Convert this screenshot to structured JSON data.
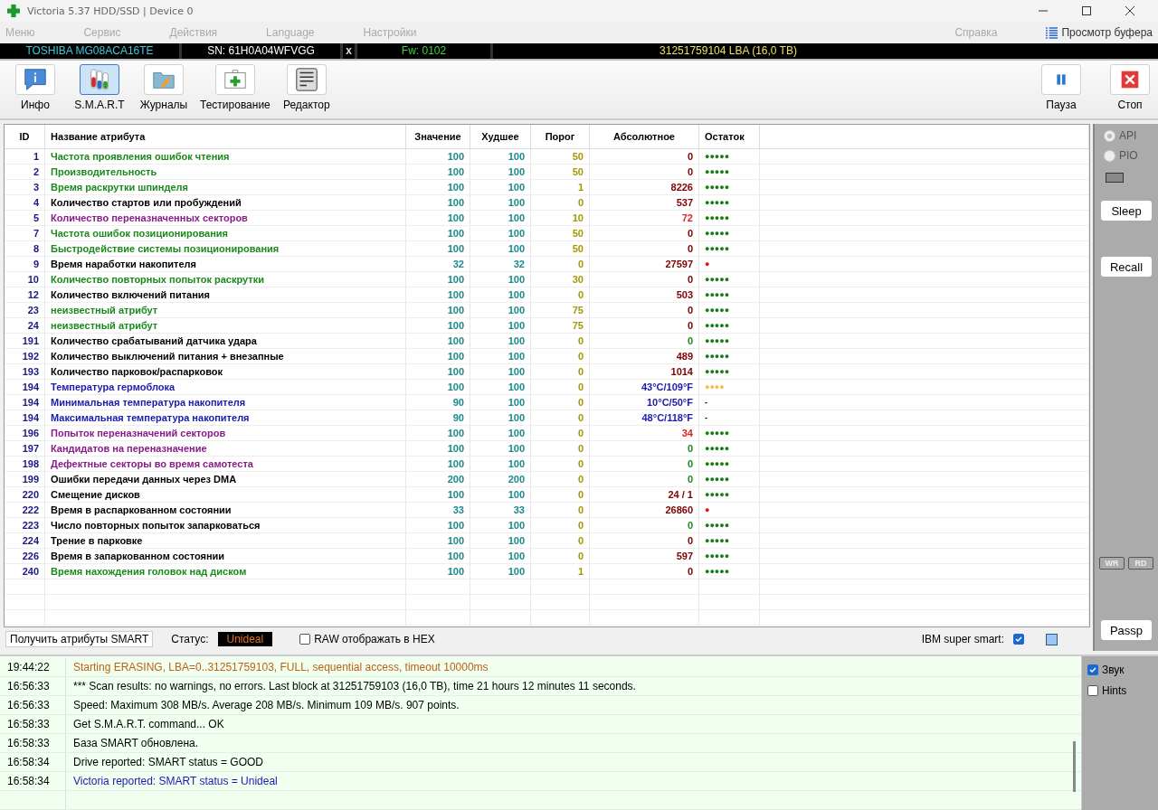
{
  "window": {
    "title": "Victoria 5.37 HDD/SSD | Device 0"
  },
  "menu": [
    {
      "label": "Меню",
      "disabled": true
    },
    {
      "label": "Сервис",
      "disabled": true
    },
    {
      "label": "Действия",
      "disabled": true
    },
    {
      "label": "Language",
      "disabled": true
    },
    {
      "label": "Настройки",
      "disabled": true
    },
    {
      "label": "Справка",
      "disabled": true
    }
  ],
  "buffer_link": {
    "label": "Просмотр буфера"
  },
  "drive_bar": {
    "model": "TOSHIBA MG08ACA16TE",
    "serial": "SN: 61H0A04WFVGG",
    "close": "x",
    "firmware": "Fw: 0102",
    "capacity": "31251759104 LBA (16,0 TB)"
  },
  "toolbar": [
    {
      "kind": "info",
      "label": "Инфо",
      "selected": false
    },
    {
      "kind": "smart",
      "label": "S.M.A.R.T",
      "selected": true
    },
    {
      "kind": "logs",
      "label": "Журналы",
      "selected": false
    },
    {
      "kind": "test",
      "label": "Тестирование",
      "selected": false
    },
    {
      "kind": "editor",
      "label": "Редактор",
      "selected": false
    }
  ],
  "toolbar_right": [
    {
      "kind": "pause",
      "label": "Пауза"
    },
    {
      "kind": "stop",
      "label": "Стоп"
    }
  ],
  "table": {
    "columns": [
      "ID",
      "Название атрибута",
      "Значение",
      "Худшее",
      "Порог",
      "Абсолютное",
      "Остаток"
    ],
    "rows": [
      {
        "id": "1",
        "name": "Частота проявления ошибок чтения",
        "color": "#1a8a1a",
        "value": "100",
        "worst": "100",
        "threshold": "50",
        "raw": {
          "text": "0",
          "color": "#800000"
        },
        "health": {
          "text": "●●●●●",
          "color": "#1a7a1a"
        }
      },
      {
        "id": "2",
        "name": "Производительность",
        "color": "#1a8a1a",
        "value": "100",
        "worst": "100",
        "threshold": "50",
        "raw": {
          "text": "0",
          "color": "#800000"
        },
        "health": {
          "text": "●●●●●",
          "color": "#1a7a1a"
        }
      },
      {
        "id": "3",
        "name": "Время раскрутки шпинделя",
        "color": "#1a8a1a",
        "value": "100",
        "worst": "100",
        "threshold": "1",
        "raw": {
          "text": "8226",
          "color": "#800000"
        },
        "health": {
          "text": "●●●●●",
          "color": "#1a7a1a"
        }
      },
      {
        "id": "4",
        "name": "Количество стартов или пробуждений",
        "color": "#000000",
        "value": "100",
        "worst": "100",
        "threshold": "0",
        "raw": {
          "text": "537",
          "color": "#800000"
        },
        "health": {
          "text": "●●●●●",
          "color": "#1a7a1a"
        }
      },
      {
        "id": "5",
        "name": "Количество переназначенных секторов",
        "color": "#8a1a8a",
        "value": "100",
        "worst": "100",
        "threshold": "10",
        "raw": {
          "text": "72",
          "color": "#e02020"
        },
        "health": {
          "text": "●●●●●",
          "color": "#1a7a1a"
        }
      },
      {
        "id": "7",
        "name": "Частота ошибок позиционирования",
        "color": "#1a8a1a",
        "value": "100",
        "worst": "100",
        "threshold": "50",
        "raw": {
          "text": "0",
          "color": "#800000"
        },
        "health": {
          "text": "●●●●●",
          "color": "#1a7a1a"
        }
      },
      {
        "id": "8",
        "name": "Быстродействие системы позиционирования",
        "color": "#1a8a1a",
        "value": "100",
        "worst": "100",
        "threshold": "50",
        "raw": {
          "text": "0",
          "color": "#800000"
        },
        "health": {
          "text": "●●●●●",
          "color": "#1a7a1a"
        }
      },
      {
        "id": "9",
        "name": "Время наработки накопителя",
        "color": "#000000",
        "value": "32",
        "worst": "32",
        "threshold": "0",
        "raw": {
          "text": "27597",
          "color": "#800000"
        },
        "health": {
          "text": "●",
          "color": "#e01010"
        }
      },
      {
        "id": "10",
        "name": "Количество повторных попыток раскрутки",
        "color": "#1a8a1a",
        "value": "100",
        "worst": "100",
        "threshold": "30",
        "raw": {
          "text": "0",
          "color": "#800000"
        },
        "health": {
          "text": "●●●●●",
          "color": "#1a7a1a"
        }
      },
      {
        "id": "12",
        "name": "Количество включений питания",
        "color": "#000000",
        "value": "100",
        "worst": "100",
        "threshold": "0",
        "raw": {
          "text": "503",
          "color": "#800000"
        },
        "health": {
          "text": "●●●●●",
          "color": "#1a7a1a"
        }
      },
      {
        "id": "23",
        "name": "неизвестный атрибут",
        "color": "#1a8a1a",
        "value": "100",
        "worst": "100",
        "threshold": "75",
        "raw": {
          "text": "0",
          "color": "#800000"
        },
        "health": {
          "text": "●●●●●",
          "color": "#1a7a1a"
        }
      },
      {
        "id": "24",
        "name": "неизвестный атрибут",
        "color": "#1a8a1a",
        "value": "100",
        "worst": "100",
        "threshold": "75",
        "raw": {
          "text": "0",
          "color": "#800000"
        },
        "health": {
          "text": "●●●●●",
          "color": "#1a7a1a"
        }
      },
      {
        "id": "191",
        "name": "Количество срабатываний датчика удара",
        "color": "#000000",
        "value": "100",
        "worst": "100",
        "threshold": "0",
        "raw": {
          "text": "0",
          "color": "#1a8a1a"
        },
        "health": {
          "text": "●●●●●",
          "color": "#1a7a1a"
        }
      },
      {
        "id": "192",
        "name": "Количество выключений питания + внезапные",
        "color": "#000000",
        "value": "100",
        "worst": "100",
        "threshold": "0",
        "raw": {
          "text": "489",
          "color": "#800000"
        },
        "health": {
          "text": "●●●●●",
          "color": "#1a7a1a"
        }
      },
      {
        "id": "193",
        "name": "Количество парковок/распарковок",
        "color": "#000000",
        "value": "100",
        "worst": "100",
        "threshold": "0",
        "raw": {
          "text": "1014",
          "color": "#800000"
        },
        "health": {
          "text": "●●●●●",
          "color": "#1a7a1a"
        }
      },
      {
        "id": "194",
        "name": "Температура гермоблока",
        "color": "#1a1ab0",
        "value": "100",
        "worst": "100",
        "threshold": "0",
        "raw": {
          "text": "43°C/109°F",
          "color": "#1a1ab0"
        },
        "health": {
          "text": "●●●●",
          "color": "#f0c040"
        }
      },
      {
        "id": "194",
        "name": "Минимальная температура накопителя",
        "color": "#1a1ab0",
        "value": "90",
        "worst": "100",
        "threshold": "0",
        "raw": {
          "text": "10°C/50°F",
          "color": "#1a1ab0"
        },
        "health": {
          "text": "-"
        }
      },
      {
        "id": "194",
        "name": "Максимальная температура накопителя",
        "color": "#1a1ab0",
        "value": "90",
        "worst": "100",
        "threshold": "0",
        "raw": {
          "text": "48°C/118°F",
          "color": "#1a1ab0"
        },
        "health": {
          "text": "-"
        }
      },
      {
        "id": "196",
        "name": "Попыток переназначений секторов",
        "color": "#8a1a8a",
        "value": "100",
        "worst": "100",
        "threshold": "0",
        "raw": {
          "text": "34",
          "color": "#e02020"
        },
        "health": {
          "text": "●●●●●",
          "color": "#1a7a1a"
        }
      },
      {
        "id": "197",
        "name": "Кандидатов на переназначение",
        "color": "#8a1a8a",
        "value": "100",
        "worst": "100",
        "threshold": "0",
        "raw": {
          "text": "0",
          "color": "#1a8a1a"
        },
        "health": {
          "text": "●●●●●",
          "color": "#1a7a1a"
        }
      },
      {
        "id": "198",
        "name": "Дефектные секторы во время самотеста",
        "color": "#8a1a8a",
        "value": "100",
        "worst": "100",
        "threshold": "0",
        "raw": {
          "text": "0",
          "color": "#1a8a1a"
        },
        "health": {
          "text": "●●●●●",
          "color": "#1a7a1a"
        }
      },
      {
        "id": "199",
        "name": "Ошибки передачи данных через DMA",
        "color": "#000000",
        "value": "200",
        "worst": "200",
        "threshold": "0",
        "raw": {
          "text": "0",
          "color": "#1a8a1a"
        },
        "health": {
          "text": "●●●●●",
          "color": "#1a7a1a"
        }
      },
      {
        "id": "220",
        "name": "Смещение дисков",
        "color": "#000000",
        "value": "100",
        "worst": "100",
        "threshold": "0",
        "raw": {
          "text": "24 / 1",
          "color": "#800000"
        },
        "health": {
          "text": "●●●●●",
          "color": "#1a7a1a"
        }
      },
      {
        "id": "222",
        "name": "Время в распаркованном состоянии",
        "color": "#000000",
        "value": "33",
        "worst": "33",
        "threshold": "0",
        "raw": {
          "text": "26860",
          "color": "#800000"
        },
        "health": {
          "text": "●",
          "color": "#e01010"
        }
      },
      {
        "id": "223",
        "name": "Число повторных попыток запарковаться",
        "color": "#000000",
        "value": "100",
        "worst": "100",
        "threshold": "0",
        "raw": {
          "text": "0",
          "color": "#1a8a1a"
        },
        "health": {
          "text": "●●●●●",
          "color": "#1a7a1a"
        }
      },
      {
        "id": "224",
        "name": "Трение в парковке",
        "color": "#000000",
        "value": "100",
        "worst": "100",
        "threshold": "0",
        "raw": {
          "text": "0",
          "color": "#800000"
        },
        "health": {
          "text": "●●●●●",
          "color": "#1a7a1a"
        }
      },
      {
        "id": "226",
        "name": "Время в запаркованном состоянии",
        "color": "#000000",
        "value": "100",
        "worst": "100",
        "threshold": "0",
        "raw": {
          "text": "597",
          "color": "#800000"
        },
        "health": {
          "text": "●●●●●",
          "color": "#1a7a1a"
        }
      },
      {
        "id": "240",
        "name": "Время нахождения головок над диском",
        "color": "#1a8a1a",
        "value": "100",
        "worst": "100",
        "threshold": "1",
        "raw": {
          "text": "0",
          "color": "#800000"
        },
        "health": {
          "text": "●●●●●",
          "color": "#1a7a1a"
        }
      }
    ]
  },
  "status_bar": {
    "get_button": "Получить атрибуты SMART",
    "status_label": "Статус:",
    "status_value": "Unideal",
    "raw_hex": {
      "label": "RAW отображать в HEX",
      "checked": false
    },
    "ibm": {
      "label": "IBM super smart:",
      "checked": true
    }
  },
  "side_panel": {
    "radios": [
      {
        "label": "API",
        "selected": true
      },
      {
        "label": "PIO",
        "selected": false
      }
    ],
    "buttons": [
      "Sleep",
      "Recall"
    ],
    "indicators": [
      "WR",
      "RD"
    ],
    "passp": "Passp"
  },
  "log": [
    {
      "time": "19:44:22",
      "text": "Starting ERASING, LBA=0..31251759103, FULL, sequential access, timeout 10000ms",
      "color": "#c06010"
    },
    {
      "time": "16:56:33",
      "text": "*** Scan results: no warnings, no errors. Last block at 31251759103 (16,0 TB), time 21 hours 12 minutes 11 seconds.",
      "color": "#000000"
    },
    {
      "time": "16:56:33",
      "text": "Speed: Maximum 308 MB/s. Average 208 MB/s. Minimum 109 MB/s. 907 points.",
      "color": "#000000"
    },
    {
      "time": "16:58:33",
      "text": "Get S.M.A.R.T. command... OK",
      "color": "#000000"
    },
    {
      "time": "16:58:33",
      "text": "База SMART обновлена.",
      "color": "#000000"
    },
    {
      "time": "16:58:34",
      "text": "Drive reported: SMART status = GOOD",
      "color": "#000000"
    },
    {
      "time": "16:58:34",
      "text": "Victoria reported: SMART status = Unideal",
      "color": "#1a1ab0"
    }
  ],
  "log_options": [
    {
      "label": "Звук",
      "checked": true
    },
    {
      "label": "Hints",
      "checked": false
    }
  ]
}
